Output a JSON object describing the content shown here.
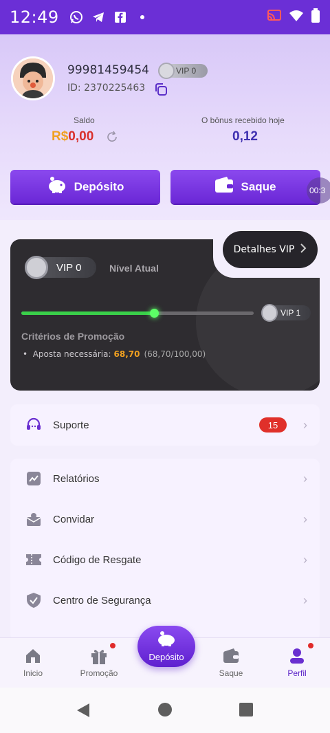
{
  "status_bar": {
    "time": "12:49"
  },
  "profile": {
    "phone": "99981459454",
    "vip_badge": "VIP 0",
    "id_text": "ID: 2370225463"
  },
  "balance": {
    "saldo_label": "Saldo",
    "saldo_currency": "R$",
    "saldo_value": "0,00",
    "bonus_label": "O bônus recebido hoje",
    "bonus_value": "0,12"
  },
  "actions": {
    "deposit_label": "Depósito",
    "withdraw_label": "Saque",
    "timer_text": "00:3"
  },
  "vip_card": {
    "details_label": "Detalhes VIP",
    "current_vip": "VIP 0",
    "current_level_label": "Nível Atual",
    "next_vip": "VIP 1",
    "progress_fraction": 0.687,
    "criteria_title": "Critérios de Promoção",
    "criteria_item": "Aposta necessária:",
    "criteria_amount": "68,70",
    "criteria_progress": "(68,70/100,00)"
  },
  "support": {
    "label": "Suporte",
    "count": "15"
  },
  "menu": {
    "items": [
      {
        "label": "Relatórios",
        "icon": "chart-report-icon"
      },
      {
        "label": "Convidar",
        "icon": "invite-envelope-icon"
      },
      {
        "label": "Código de Resgate",
        "icon": "ticket-icon"
      },
      {
        "label": "Centro de Segurança",
        "icon": "shield-check-icon"
      }
    ]
  },
  "bottom_nav": {
    "items": [
      {
        "label": "Inicio",
        "icon": "home-icon"
      },
      {
        "label": "Promoção",
        "icon": "gift-icon"
      },
      {
        "label": "Depósito",
        "icon": "piggy-bank-icon"
      },
      {
        "label": "Saque",
        "icon": "wallet-icon"
      },
      {
        "label": "Perfil",
        "icon": "user-icon"
      }
    ]
  },
  "colors": {
    "primary": "#6b2fd6",
    "accent_orange": "#f0a020",
    "badge_red": "#e0302a",
    "vip_card_bg": "#2e2c30",
    "progress_green": "#3ad04a"
  }
}
